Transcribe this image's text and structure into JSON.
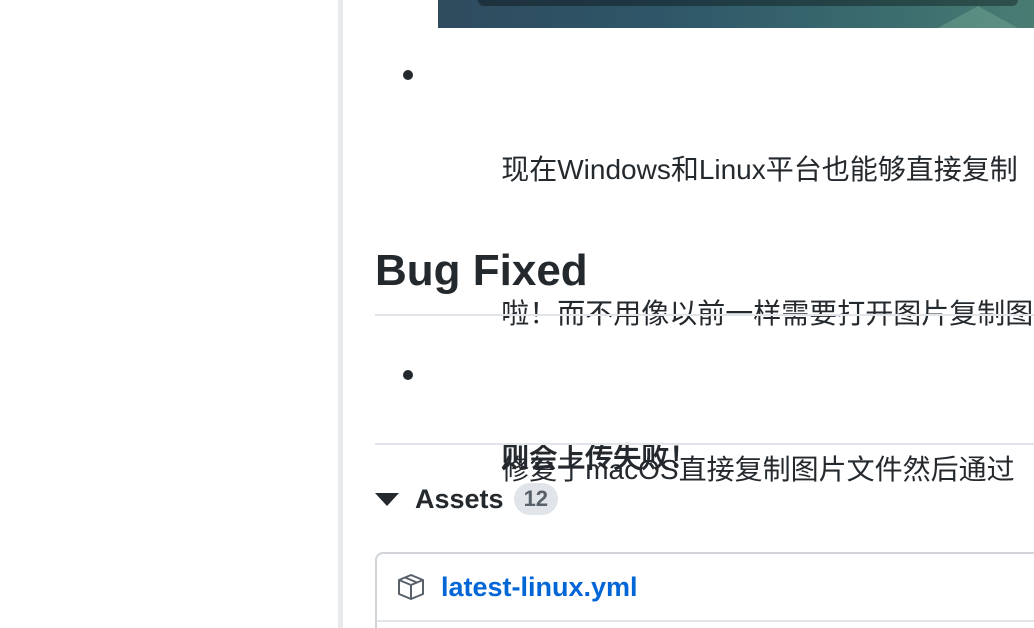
{
  "release_notes": {
    "bullets_top": [
      {
        "text": "现在Windows和Linux平台也能够直接复制"
      },
      {
        "text": "啦！而不用像以前一样需要打开图片复制图"
      },
      {
        "text": "则会上传失败！",
        "bold": true
      }
    ],
    "section_title": "Bug Fixed",
    "bullets_bug": [
      {
        "text": "修复了macOS直接复制图片文件然后通过"
      }
    ]
  },
  "assets": {
    "label": "Assets",
    "count": "12",
    "items": [
      {
        "name": "latest-linux.yml",
        "icon": "package-icon"
      }
    ]
  },
  "colors": {
    "text": "#24292e",
    "link": "#0366d6",
    "border": "#e1e4e8",
    "counter_bg": "#e1e4e8"
  }
}
